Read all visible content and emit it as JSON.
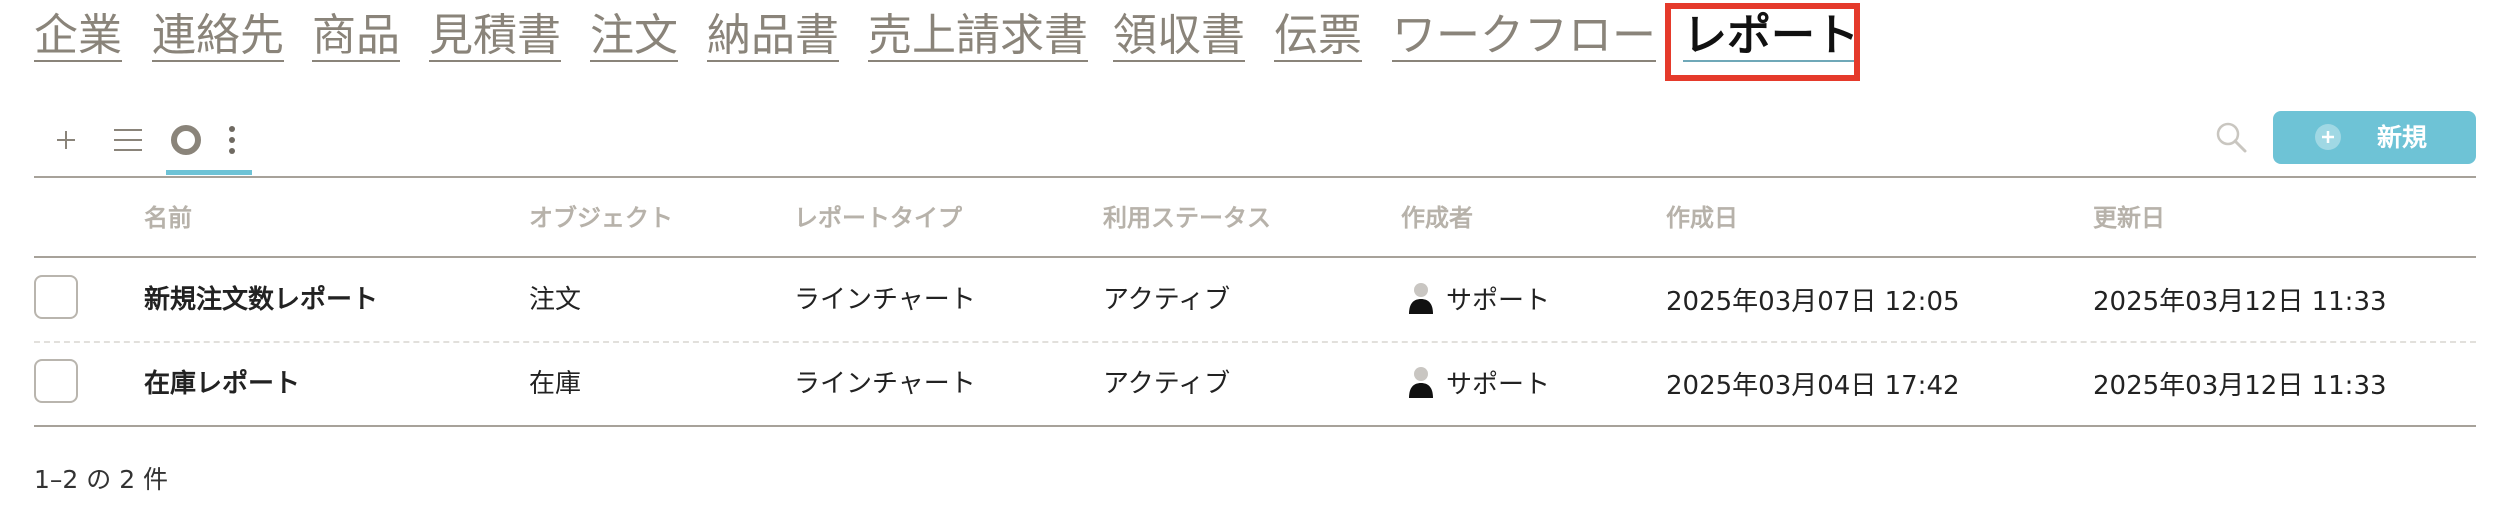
{
  "nav": {
    "tabs": [
      {
        "label": "企業"
      },
      {
        "label": "連絡先"
      },
      {
        "label": "商品"
      },
      {
        "label": "見積書"
      },
      {
        "label": "注文"
      },
      {
        "label": "納品書"
      },
      {
        "label": "売上請求書"
      },
      {
        "label": "領収書"
      },
      {
        "label": "伝票"
      },
      {
        "label": "ワークフロー"
      },
      {
        "label": "レポート",
        "active": true
      }
    ]
  },
  "toolbar": {
    "icons": [
      "plus-icon",
      "list-icon",
      "circle-view-icon",
      "more-vertical-icon",
      "search-icon"
    ],
    "new_button_label": "新規"
  },
  "table": {
    "columns": [
      "名前",
      "オブジェクト",
      "レポートタイプ",
      "利用ステータス",
      "作成者",
      "作成日",
      "更新日"
    ],
    "rows": [
      {
        "name": "新規注文数レポート",
        "object": "注文",
        "report_type": "ラインチャート",
        "status": "アクティブ",
        "creator": "サポート",
        "created": "2025年03月07日 12:05",
        "updated": "2025年03月12日 11:33"
      },
      {
        "name": "在庫レポート",
        "object": "在庫",
        "report_type": "ラインチャート",
        "status": "アクティブ",
        "creator": "サポート",
        "created": "2025年03月04日 17:42",
        "updated": "2025年03月12日 11:33"
      }
    ]
  },
  "footer": {
    "count_text": "1–2 の 2 件"
  },
  "colors": {
    "accent": "#6ec3d6",
    "highlight_box": "#e53a2b",
    "tab_text": "#8a847a",
    "header_text": "#b7b2aa"
  }
}
